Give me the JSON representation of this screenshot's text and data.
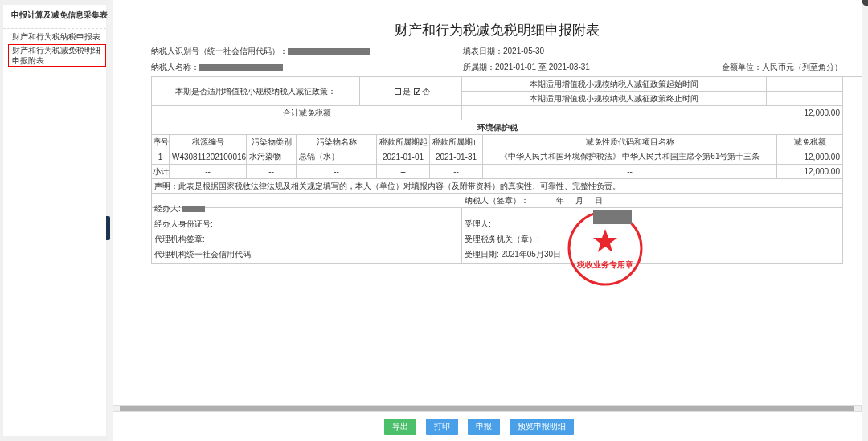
{
  "sidebar": {
    "title": "申报计算及减免信息采集表",
    "items": [
      {
        "label": "财产和行为税纳税申报表",
        "selected": false
      },
      {
        "label": "财产和行为税减免税明细申报附表",
        "selected": true
      }
    ]
  },
  "form": {
    "title": "财产和行为税减免税明细申报附表",
    "header": {
      "taxpayer_id_label": "纳税人识别号（统一社会信用代码）：",
      "fill_date": "填表日期：2021-05-30",
      "taxpayer_name_label": "纳税人名称：",
      "period": "所属期：2021-01-01 至 2021-03-31",
      "unit": "金额单位：人民币元（列至角分）"
    },
    "policy": {
      "question": "本期是否适用增值税小规模纳税人减征政策：",
      "options": [
        {
          "label": "是",
          "checked": false
        },
        {
          "label": "否",
          "checked": true
        }
      ],
      "start_label": "本期适用增值税小规模纳税人减征政策起始时间",
      "end_label": "本期适用增值税小规模纳税人减征政策终止时间"
    },
    "total": {
      "label": "合计减免税额",
      "value": "12,000.00"
    },
    "section_title": "环境保护税",
    "columns": [
      "序号",
      "税源编号",
      "污染物类别",
      "污染物名称",
      "税款所属期起",
      "税款所属期止",
      "减免性质代码和项目名称",
      "减免税额"
    ],
    "rows": [
      [
        "1",
        "W430811202100016",
        "水污染物",
        "总镉（水）",
        "2021-01-01",
        "2021-01-31",
        "《中华人民共和国环境保护税法》 中华人民共和国主席令第61号第十三条",
        "12,000.00"
      ]
    ],
    "subtotal": [
      "小计",
      "--",
      "--",
      "--",
      "--",
      "--",
      "--",
      "12,000.00"
    ],
    "declaration": "声明：此表是根据国家税收法律法规及相关规定填写的，本人（单位）对填报内容（及附带资料）的真实性、可靠性、完整性负责。",
    "signature": [
      "纳税人（签章）：",
      "年",
      "月",
      "日"
    ],
    "agent": [
      "经办人:",
      "经办人身份证号:",
      "代理机构签章:",
      "代理机构统一社会信用代码:"
    ],
    "receiver": [
      "受理人:",
      "受理税务机关（章）:",
      "受理日期: 2021年05月30日"
    ],
    "seal_text": "税收业务专用章"
  },
  "buttons": [
    {
      "label": "导出",
      "kind": "success"
    },
    {
      "label": "打印",
      "kind": "primary"
    },
    {
      "label": "申报",
      "kind": "primary"
    },
    {
      "label": "预览申报明细",
      "kind": "primary"
    }
  ]
}
